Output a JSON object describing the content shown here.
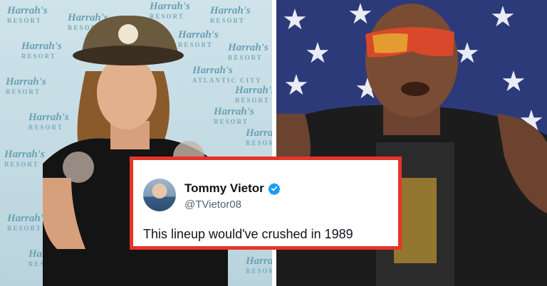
{
  "left_photo": {
    "wall_brand": "Harrah's",
    "wall_sub_resort": "RESORT",
    "wall_sub_city": "ATLANTIC CITY"
  },
  "tweet": {
    "display_name": "Tommy Vietor",
    "handle": "@TVietor08",
    "text": "This lineup would've crushed in 1989",
    "verified_color": "#1d9bf0",
    "border_color": "#e8332a"
  },
  "icons": {
    "verified": "verified-badge-icon",
    "avatar": "avatar"
  }
}
